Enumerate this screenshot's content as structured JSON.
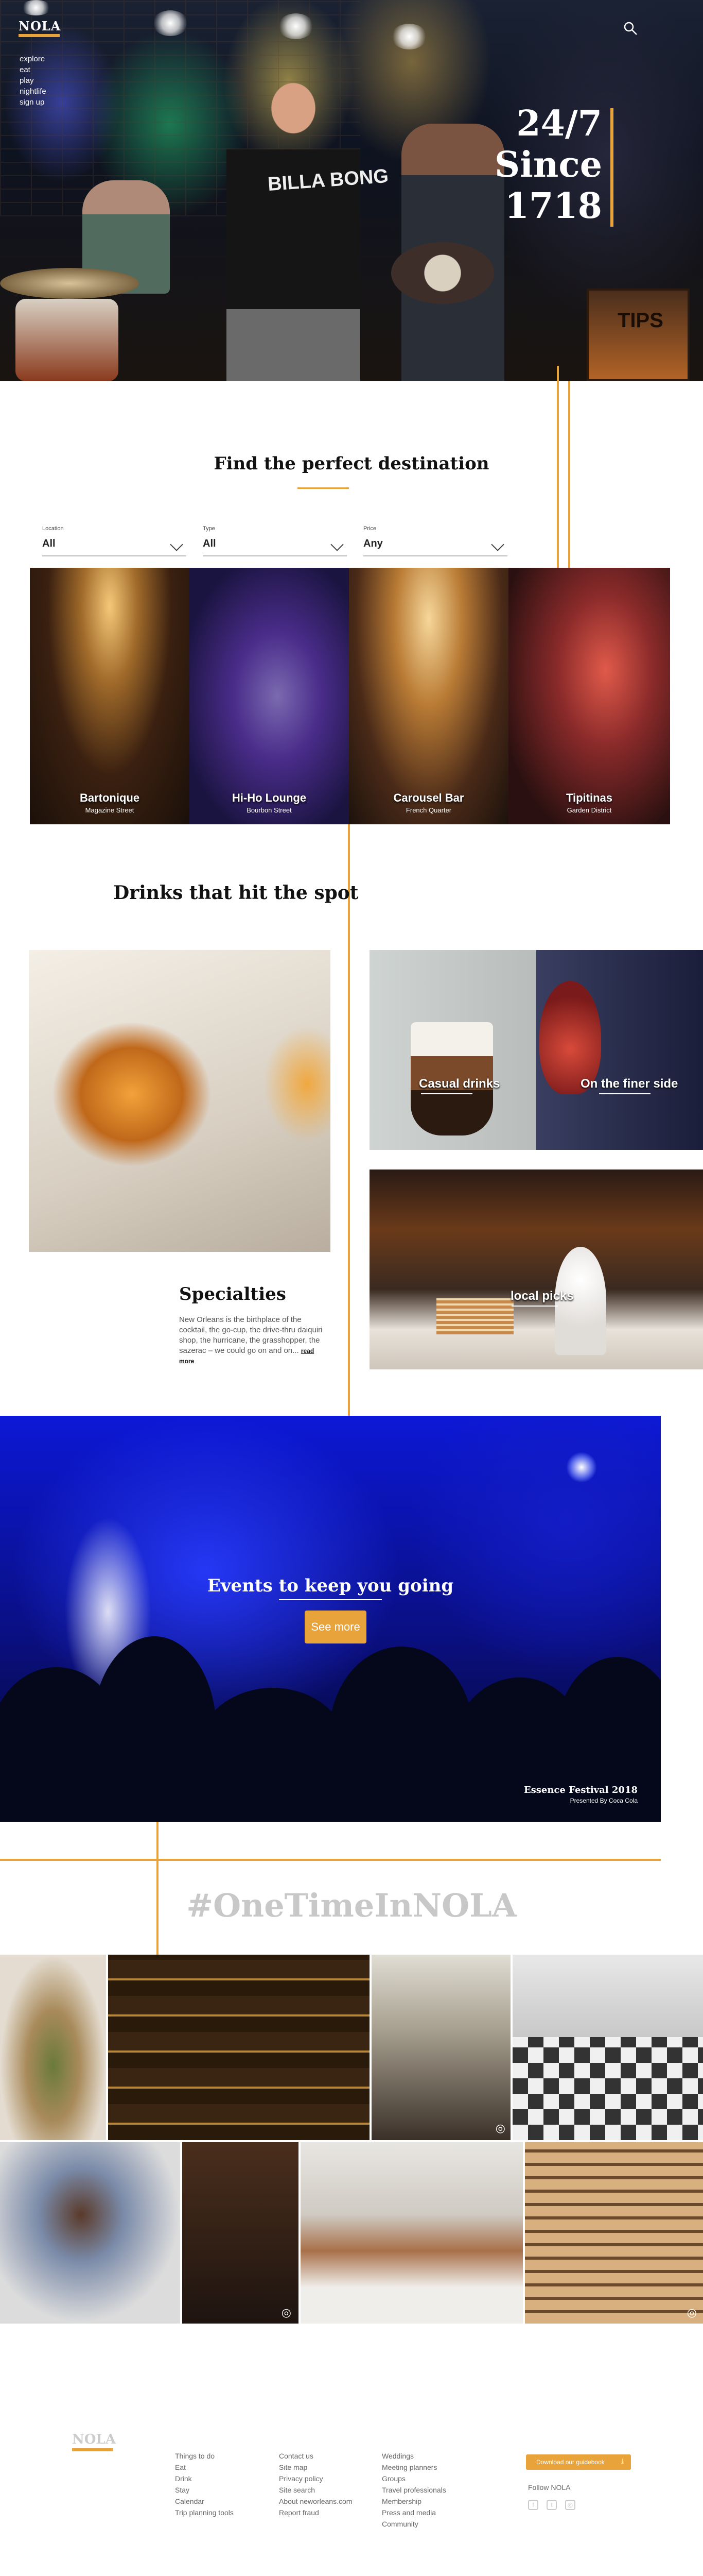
{
  "brand": {
    "logo": "NOLA",
    "accent": "#e8a33b"
  },
  "nav": {
    "items": [
      "explore",
      "eat",
      "play",
      "nightlife",
      "sign up"
    ]
  },
  "hero": {
    "title_lines": [
      "24/7",
      "Since",
      "1718"
    ],
    "shirt_text": "BILLA BONG",
    "amp_text": "TIPS"
  },
  "destination": {
    "title": "Find the perfect destination",
    "filters": [
      {
        "label": "Location",
        "value": "All"
      },
      {
        "label": "Type",
        "value": "All"
      },
      {
        "label": "Price",
        "value": "Any"
      }
    ],
    "places": [
      {
        "name": "Bartonique",
        "area": "Magazine Street"
      },
      {
        "name": "Hi-Ho Lounge",
        "area": "Bourbon Street"
      },
      {
        "name": "Carousel Bar",
        "area": "French Quarter"
      },
      {
        "name": "Tipitinas",
        "area": "Garden District"
      }
    ]
  },
  "drinks": {
    "title": "Drinks that hit the spot",
    "tiles": [
      "Casual drinks",
      "On the finer side",
      "local picks"
    ],
    "specialties_title": "Specialties",
    "specialties_text": "New Orleans is the birthplace of the cocktail, the go-cup, the drive-thru daiquiri shop, the hurricane, the grasshopper, the sazerac – we could go on and on...",
    "read_more": "read more"
  },
  "events": {
    "title": "Events to keep you going",
    "button": "See more",
    "caption_title": "Essence Festival 2018",
    "caption_sub": "Presented By Coca Cola"
  },
  "hashtag": "#OneTimeInNOLA",
  "footer": {
    "logo": "NOLA",
    "col1": [
      "Things to do",
      "Eat",
      "Drink",
      "Stay",
      "Calendar",
      "Trip planning tools"
    ],
    "col2": [
      "Contact us",
      "Site map",
      "Privacy policy",
      "Site search",
      "About neworleans.com",
      "Report fraud"
    ],
    "col3": [
      "Weddings",
      "Meeting planners",
      "Groups",
      "Travel professionals",
      "Membership",
      "Press and media",
      "Community"
    ],
    "download": "Download our guidebook",
    "follow": "Follow NOLA",
    "social": [
      "facebook-icon",
      "twitter-icon",
      "instagram-icon"
    ]
  }
}
